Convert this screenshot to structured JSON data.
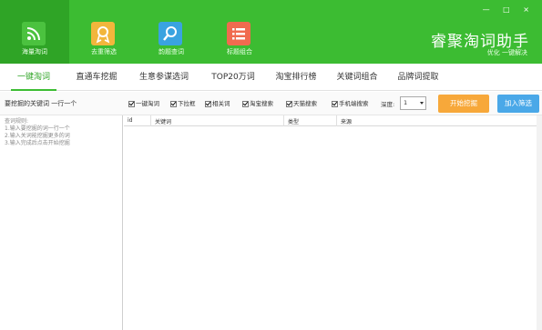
{
  "app": {
    "title": "睿聚淘词助手",
    "subtitle": "优化 一键解决",
    "window_controls": "— □ ×"
  },
  "nav": [
    {
      "label": "海量淘词",
      "icon": "rss-icon",
      "color": "#4bc23f"
    },
    {
      "label": "去重筛选",
      "icon": "award-icon",
      "color": "#f2b63c"
    },
    {
      "label": "韵题查词",
      "icon": "search-icon",
      "color": "#3aa3e0"
    },
    {
      "label": "标题组合",
      "icon": "list-icon",
      "color": "#f06b4f"
    }
  ],
  "tabs": [
    "一键淘词",
    "直通车挖掘",
    "生意参谋选词",
    "TOP20万词",
    "淘宝排行榜",
    "关键词组合",
    "品牌词提取"
  ],
  "toolbar": {
    "keyword_label": "要挖掘的关键词 一行一个",
    "checkboxes": [
      "一键淘词",
      "下拉框",
      "相关词",
      "淘宝搜索",
      "天猫搜索",
      "手机端搜索"
    ],
    "depth_label": "深度:",
    "depth_value": "1",
    "start_button": "开始挖掘",
    "add_button": "加入筛选"
  },
  "left_panel": {
    "lines": [
      "查词规则:",
      "1.输入要挖掘的词一行一个",
      "2.输入关词能挖掘更多的词",
      "3.输入完成后点击开始挖掘"
    ]
  },
  "table": {
    "columns": [
      "id",
      "关键词",
      "类型",
      "来源"
    ]
  },
  "colors": {
    "header": "#3cbc32",
    "accent": "#2fa426",
    "start": "#f7a83a",
    "add": "#4aa8e8"
  }
}
